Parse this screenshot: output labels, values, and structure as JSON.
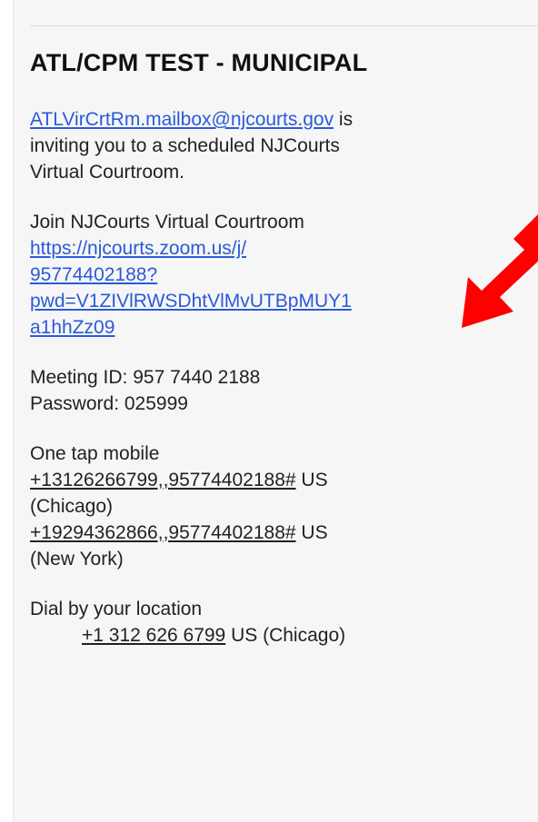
{
  "email": {
    "title": "ATL/CPM TEST - MUNICIPAL",
    "invite": {
      "sender": "ATLVirCrtRm.mailbox@njcourts.gov",
      "line1_rest": " is",
      "line2": "inviting you to a scheduled NJCourts",
      "line3": "Virtual Courtroom."
    },
    "join": {
      "label": "Join NJCourts Virtual Courtroom",
      "url_lines": [
        "https://njcourts.zoom.us/j/",
        "95774402188?",
        "pwd=V1ZIVlRWSDhtVlMvUTBpMUY1",
        "a1hhZz09"
      ]
    },
    "meeting": {
      "id_line": "Meeting ID: 957 7440 2188",
      "password_line": "Password: 025999"
    },
    "one_tap": {
      "label": "One tap mobile",
      "entries": [
        {
          "number": "+13126266799,,95774402188#",
          "suffix": " US",
          "city": "(Chicago)"
        },
        {
          "number": "+19294362866,,95774402188#",
          "suffix": " US",
          "city": "(New York)"
        }
      ]
    },
    "dial": {
      "label": "Dial by your location",
      "entries": [
        {
          "number": "+1 312 626 6799",
          "suffix": " US (Chicago)"
        }
      ]
    }
  },
  "annotation": {
    "arrow_icon": "red-arrow-icon",
    "color": "#ff0000"
  },
  "colors": {
    "link": "#2a5bd7",
    "panel_background": "#f6f6f6",
    "text": "#222222"
  }
}
